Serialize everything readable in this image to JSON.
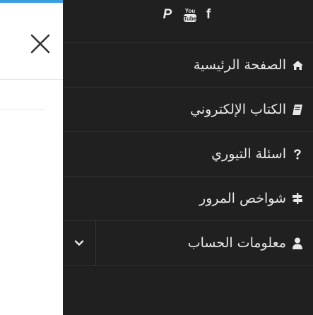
{
  "social": {
    "items": [
      {
        "icon": "facebook-icon",
        "glyph": "f"
      },
      {
        "icon": "youtube-icon",
        "top": "You",
        "bottom": "Tube"
      },
      {
        "icon": "paypal-icon",
        "glyph": "P"
      }
    ]
  },
  "menu": {
    "items": [
      {
        "label": "الصفحة الرئيسية",
        "icon": "home-icon"
      },
      {
        "label": "الكتاب الإلكتروني",
        "icon": "book-icon"
      },
      {
        "label": "اسئلة التيوري",
        "icon": "question-icon"
      },
      {
        "label": "شواخص المرور",
        "icon": "signs-icon"
      },
      {
        "label": "معلومات الحساب",
        "icon": "user-icon"
      }
    ]
  },
  "colors": {
    "drawer_bg": "#202020",
    "accent_bar": "#3a9fe0",
    "text": "#e8e8e8"
  }
}
